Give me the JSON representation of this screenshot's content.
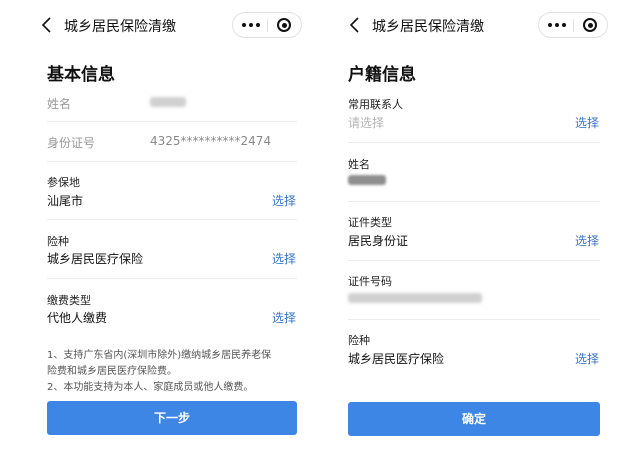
{
  "left_screen": {
    "title": "城乡居民保险清缴",
    "heading": "基本信息",
    "name_label": "姓名",
    "id_label": "身份证号",
    "id_value": "4325**********2474",
    "insured_place": {
      "label": "参保地",
      "value": "汕尾市",
      "action": "选择"
    },
    "insurance_type": {
      "label": "险种",
      "value": "城乡居民医疗保险",
      "action": "选择"
    },
    "payment_type": {
      "label": "缴费类型",
      "value": "代他人缴费",
      "action": "选择"
    },
    "notes": [
      "1、支持广东省内(深圳市除外)缴纳城乡居民养老保",
      "险费和城乡居民医疗保险费。",
      "2、本功能支持为本人、家庭成员或他人缴费。"
    ],
    "next_button": "下一步"
  },
  "right_screen": {
    "title": "城乡居民保险清缴",
    "heading": "户籍信息",
    "contact": {
      "label": "常用联系人",
      "placeholder": "请选择",
      "action": "选择"
    },
    "name_label": "姓名",
    "cert_type": {
      "label": "证件类型",
      "value": "居民身份证",
      "action": "选择"
    },
    "cert_number_label": "证件号码",
    "insurance_type": {
      "label": "险种",
      "value": "城乡居民医疗保险",
      "action": "选择"
    },
    "confirm_button": "确定"
  },
  "capsule_icons": [
    "more-dots-icon",
    "target-icon"
  ],
  "colors": {
    "link": "#3a76c8",
    "button": "#3d86e6",
    "divider": "#ececec"
  }
}
